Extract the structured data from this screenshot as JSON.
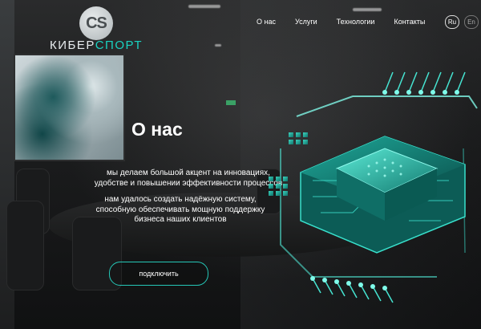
{
  "brand": {
    "logo_letters": "CS",
    "name_part1": "КИБЕР",
    "name_part2": "СПОРТ",
    "accent_color": "#19d3c2"
  },
  "nav": {
    "items": [
      "О нас",
      "Услуги",
      "Технологии",
      "Контакты"
    ]
  },
  "languages": {
    "ru": "Ru",
    "en": "En"
  },
  "hero": {
    "title": "О нас",
    "paragraph1": "мы делаем большой акцент на инновациях, удобстве и повышении эффективности процессов",
    "paragraph2": "нам удалось создать надёжную систему, способную обеспечивать мощную поддержку бизнеса наших клиентов",
    "cta_label": "подключить"
  },
  "icons": {
    "chip": "microchip-icon"
  }
}
